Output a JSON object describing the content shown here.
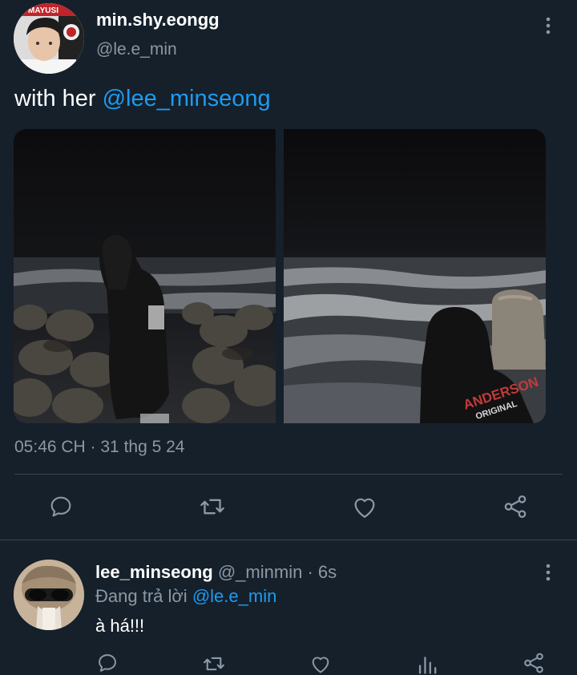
{
  "tweet": {
    "display_name": "min.shy.eongg",
    "handle": "@le.e_min",
    "avatar_badge": "MAYUSI",
    "text_prefix": "with her",
    "mention": "@lee_minseong",
    "timestamp": "05:46 CH · 31 thg 5 24",
    "photo_right_print": "ANDERSON",
    "photo_right_print_2": "ORIGINAL",
    "icons": [
      "reply-icon",
      "retweet-icon",
      "like-icon",
      "share-icon"
    ]
  },
  "reply": {
    "display_name": "lee_minseong",
    "handle": "@_minmin",
    "time": "· 6s",
    "replying_prefix": "Đang trả lời",
    "replying_to": "@le.e_min",
    "text": "à há!!!",
    "icons": [
      "reply-icon",
      "retweet-icon",
      "like-icon",
      "views-icon",
      "share-icon"
    ]
  },
  "colors": {
    "background": "#15202b",
    "accent": "#1d9bf0",
    "muted": "#8b98a5",
    "divider": "#38444d"
  }
}
